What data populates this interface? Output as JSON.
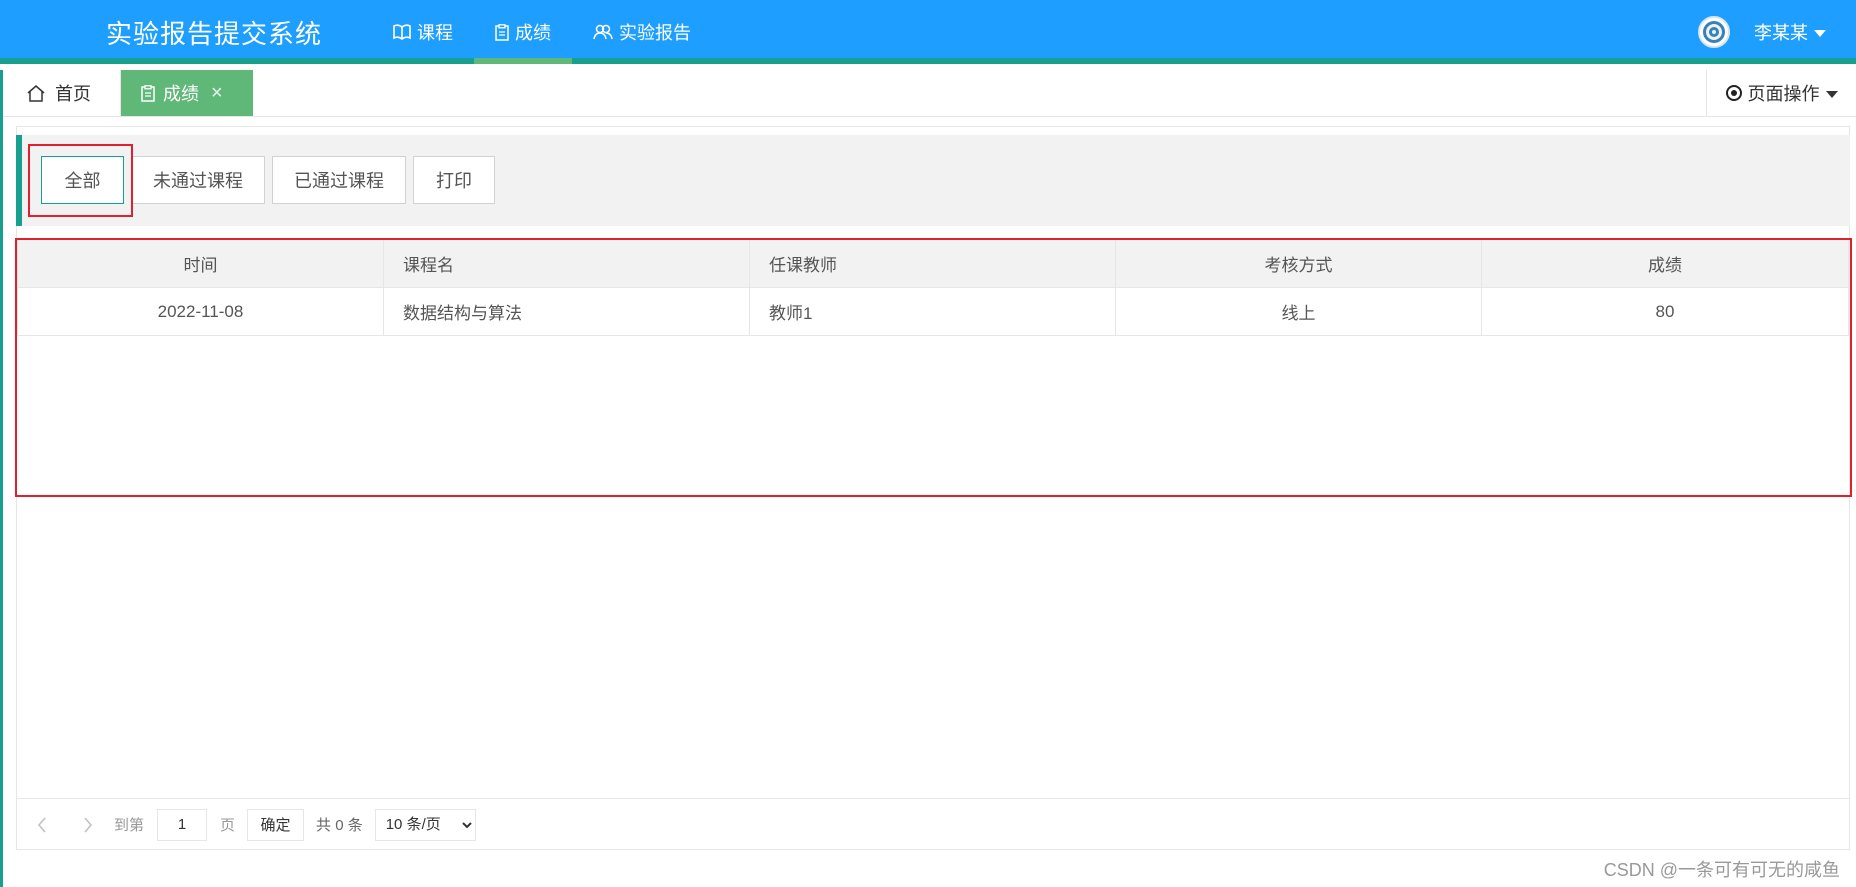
{
  "header": {
    "app_title": "实验报告提交系统",
    "nav": [
      {
        "label": "课程",
        "icon": "book-icon",
        "active": false
      },
      {
        "label": "成绩",
        "icon": "clipboard-icon",
        "active": true
      },
      {
        "label": "实验报告",
        "icon": "users-icon",
        "active": false
      }
    ],
    "user_name": "李某某"
  },
  "tabs": {
    "home_label": "首页",
    "current_label": "成绩",
    "page_ops_label": "页面操作"
  },
  "filters": {
    "all": "全部",
    "failed": "未通过课程",
    "passed": "已通过课程",
    "print": "打印"
  },
  "table": {
    "columns": [
      "时间",
      "课程名",
      "任课教师",
      "考核方式",
      "成绩"
    ],
    "rows": [
      [
        "2022-11-08",
        "数据结构与算法",
        "教师1",
        "线上",
        "80"
      ]
    ]
  },
  "pager": {
    "goto_label": "到第",
    "page_value": "1",
    "page_unit": "页",
    "confirm_label": "确定",
    "total_label": "共 0 条",
    "page_size_selected": "10 条/页"
  },
  "watermark": "CSDN @一条可有可无的咸鱼",
  "colors": {
    "header_blue": "#1e9fff",
    "accent_teal": "#17a090",
    "active_green": "#5fb878",
    "highlight_red": "#e0202c"
  }
}
